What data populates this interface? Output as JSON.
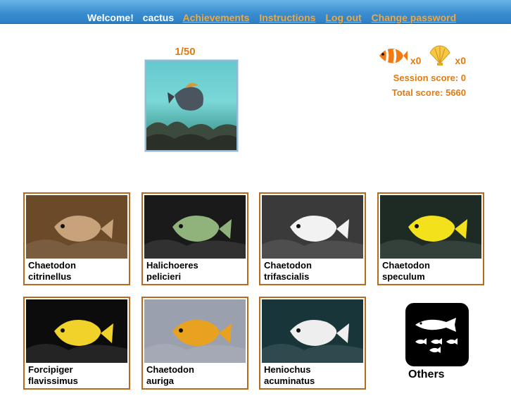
{
  "topbar": {
    "welcome": "Welcome!",
    "username": "cactus",
    "links": [
      "Achievements",
      "Instructions",
      "Log out",
      "Change password"
    ]
  },
  "quiz": {
    "counter": "1/50"
  },
  "stats": {
    "clownfish_count": "x0",
    "shell_count": "x0",
    "session_score": "Session score: 0",
    "total_score": "Total score: 5660"
  },
  "choices": [
    {
      "name": "Chaetodon\ncitrinellus",
      "icon": "fish-photo",
      "bg": "#6b4a2a",
      "fish": "#c7a27a"
    },
    {
      "name": "Halichoeres\npelicieri",
      "icon": "fish-photo",
      "bg": "#1a1a1a",
      "fish": "#8fb37a"
    },
    {
      "name": "Chaetodon\ntrifascialis",
      "icon": "fish-photo",
      "bg": "#3a3a3a",
      "fish": "#f2f2f2"
    },
    {
      "name": "Chaetodon\nspeculum",
      "icon": "fish-photo",
      "bg": "#1d2b24",
      "fish": "#f3e11c"
    },
    {
      "name": "Forcipiger\nflavissimus",
      "icon": "fish-photo",
      "bg": "#0c0c0c",
      "fish": "#f1d22a"
    },
    {
      "name": "Chaetodon\nauriga",
      "icon": "fish-photo",
      "bg": "#9aa0ad",
      "fish": "#e8a21f"
    },
    {
      "name": "Heniochus\nacuminatus",
      "icon": "fish-photo",
      "bg": "#18363a",
      "fish": "#eeeeee"
    }
  ],
  "others": {
    "label": "Others"
  },
  "colors": {
    "accent": "#e07b12",
    "card_border": "#b66a1e",
    "topbar": "#3b8fd0"
  }
}
